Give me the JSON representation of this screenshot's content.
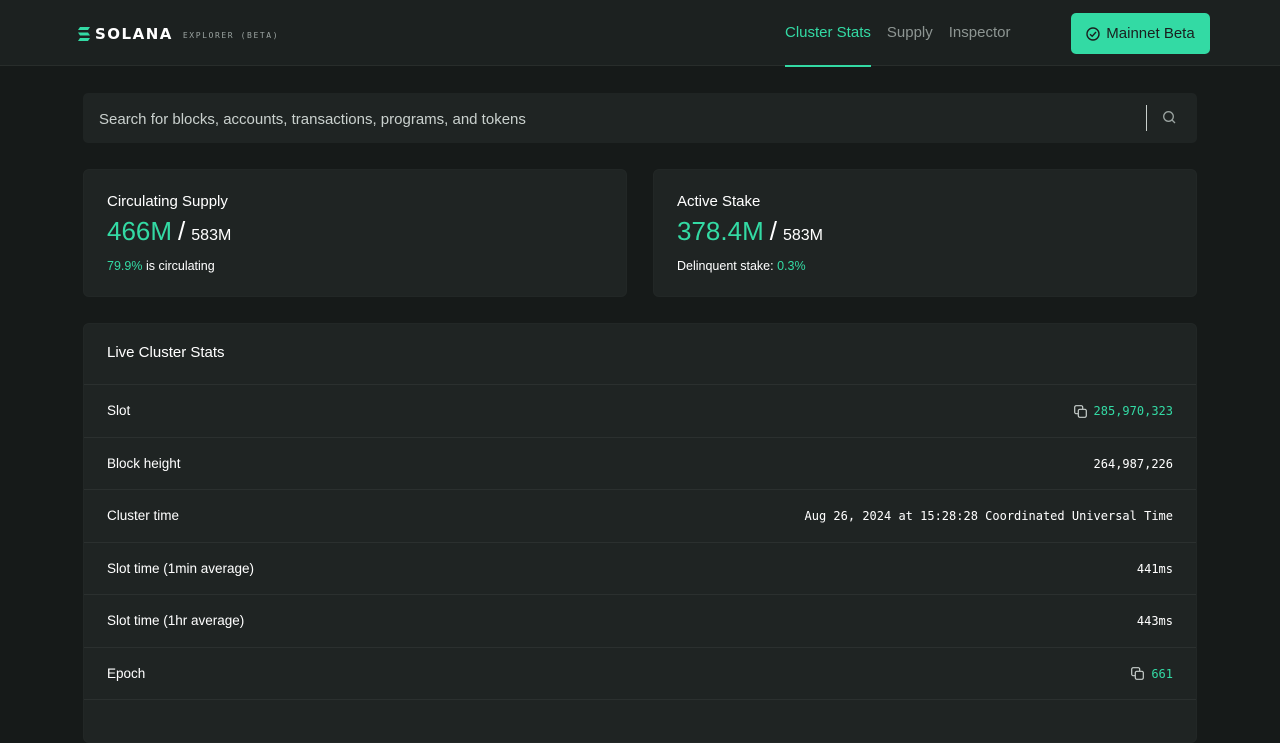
{
  "header": {
    "brand": "SOLANA",
    "brand_sub": "EXPLORER (BETA)",
    "nav": [
      {
        "label": "Cluster Stats",
        "active": true
      },
      {
        "label": "Supply",
        "active": false
      },
      {
        "label": "Inspector",
        "active": false
      }
    ],
    "cluster_button": "Mainnet Beta"
  },
  "search": {
    "placeholder": "Search for blocks, accounts, transactions, programs, and tokens"
  },
  "supply_card": {
    "title": "Circulating Supply",
    "value": "466M",
    "slash": "/",
    "total": "583M",
    "percent": "79.9%",
    "suffix": "is circulating"
  },
  "stake_card": {
    "title": "Active Stake",
    "value": "378.4M",
    "slash": "/",
    "total": "583M",
    "prefix": "Delinquent stake:",
    "percent": "0.3%"
  },
  "live_stats": {
    "title": "Live Cluster Stats",
    "rows": [
      {
        "label": "Slot",
        "value": "285,970,323"
      },
      {
        "label": "Block height",
        "value": "264,987,226"
      },
      {
        "label": "Cluster time",
        "value": "Aug 26, 2024 at 15:28:28 Coordinated Universal Time"
      },
      {
        "label": "Slot time (1min average)",
        "value": "441ms"
      },
      {
        "label": "Slot time (1hr average)",
        "value": "443ms"
      },
      {
        "label": "Epoch",
        "value": "661"
      }
    ]
  },
  "colors": {
    "accent": "#33daa4",
    "background": "#161a19",
    "card": "#1f2423"
  }
}
